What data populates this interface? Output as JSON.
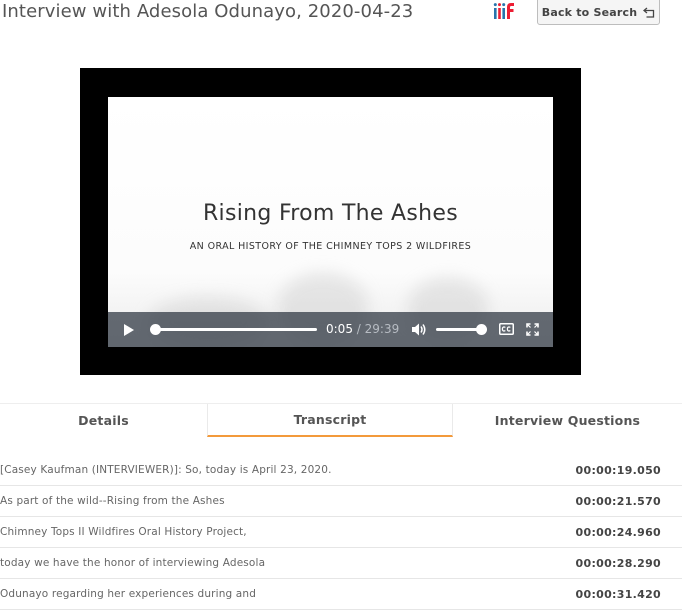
{
  "header": {
    "title": "Interview with Adesola Odunayo, 2020-04-23",
    "back_button_label": "Back to Search",
    "logo_icon": "iiif-logo"
  },
  "player": {
    "poster_title": "Rising From The Ashes",
    "poster_subtitle": "AN ORAL HISTORY OF THE CHIMNEY TOPS 2 WILDFIRES",
    "current_time": "0:05",
    "time_separator": "/",
    "duration": "29:39",
    "progress_fraction": 0.003,
    "volume_fraction": 1.0,
    "icons": [
      "play-icon",
      "volume-icon",
      "captions-icon",
      "fullscreen-icon"
    ]
  },
  "tabs": [
    {
      "label": "Details",
      "active": false
    },
    {
      "label": "Transcript",
      "active": true
    },
    {
      "label": "Interview Questions",
      "active": false
    }
  ],
  "transcript": [
    {
      "text": "[Casey Kaufman (INTERVIEWER)]: So, today is April 23, 2020.",
      "timestamp": "00:00:19.050"
    },
    {
      "text": "As part of the wild--Rising from the Ashes",
      "timestamp": "00:00:21.570"
    },
    {
      "text": "Chimney Tops II Wildfires Oral History Project,",
      "timestamp": "00:00:24.960"
    },
    {
      "text": "today we have the honor of interviewing Adesola",
      "timestamp": "00:00:28.290"
    },
    {
      "text": "Odunayo regarding her experiences during and",
      "timestamp": "00:00:31.420"
    }
  ],
  "colors": {
    "accent": "#f39a3b",
    "iiif_blue": "#2873ab",
    "iiif_red": "#ed1d33"
  }
}
